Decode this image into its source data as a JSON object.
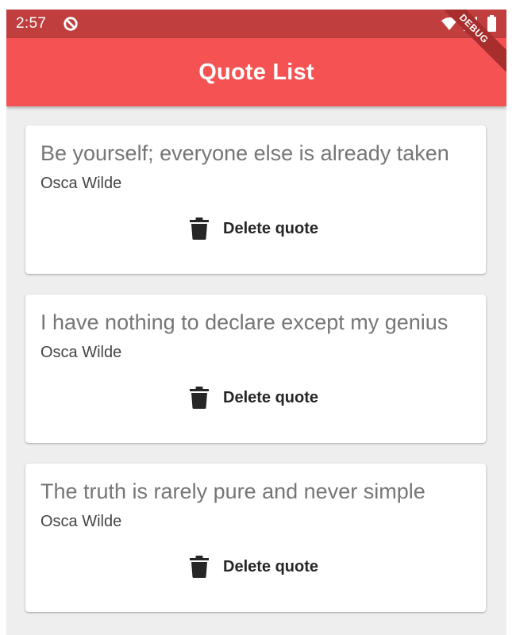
{
  "status_bar": {
    "time": "2:57",
    "background_color": "#c03e3e",
    "icons": [
      "app-notification-icon",
      "wifi-icon",
      "signal-icon",
      "battery-icon"
    ]
  },
  "app_bar": {
    "title": "Quote List",
    "background_color": "#f55353",
    "debug_banner": "DEBUG"
  },
  "quotes": [
    {
      "text": "Be yourself; everyone else is already taken",
      "author": "Osca Wilde",
      "action_label": "Delete quote",
      "action_icon": "trash-icon"
    },
    {
      "text": "I have nothing to declare except my genius",
      "author": "Osca Wilde",
      "action_label": "Delete quote",
      "action_icon": "trash-icon"
    },
    {
      "text": "The truth is rarely pure and never simple",
      "author": "Osca Wilde",
      "action_label": "Delete quote",
      "action_icon": "trash-icon"
    }
  ]
}
